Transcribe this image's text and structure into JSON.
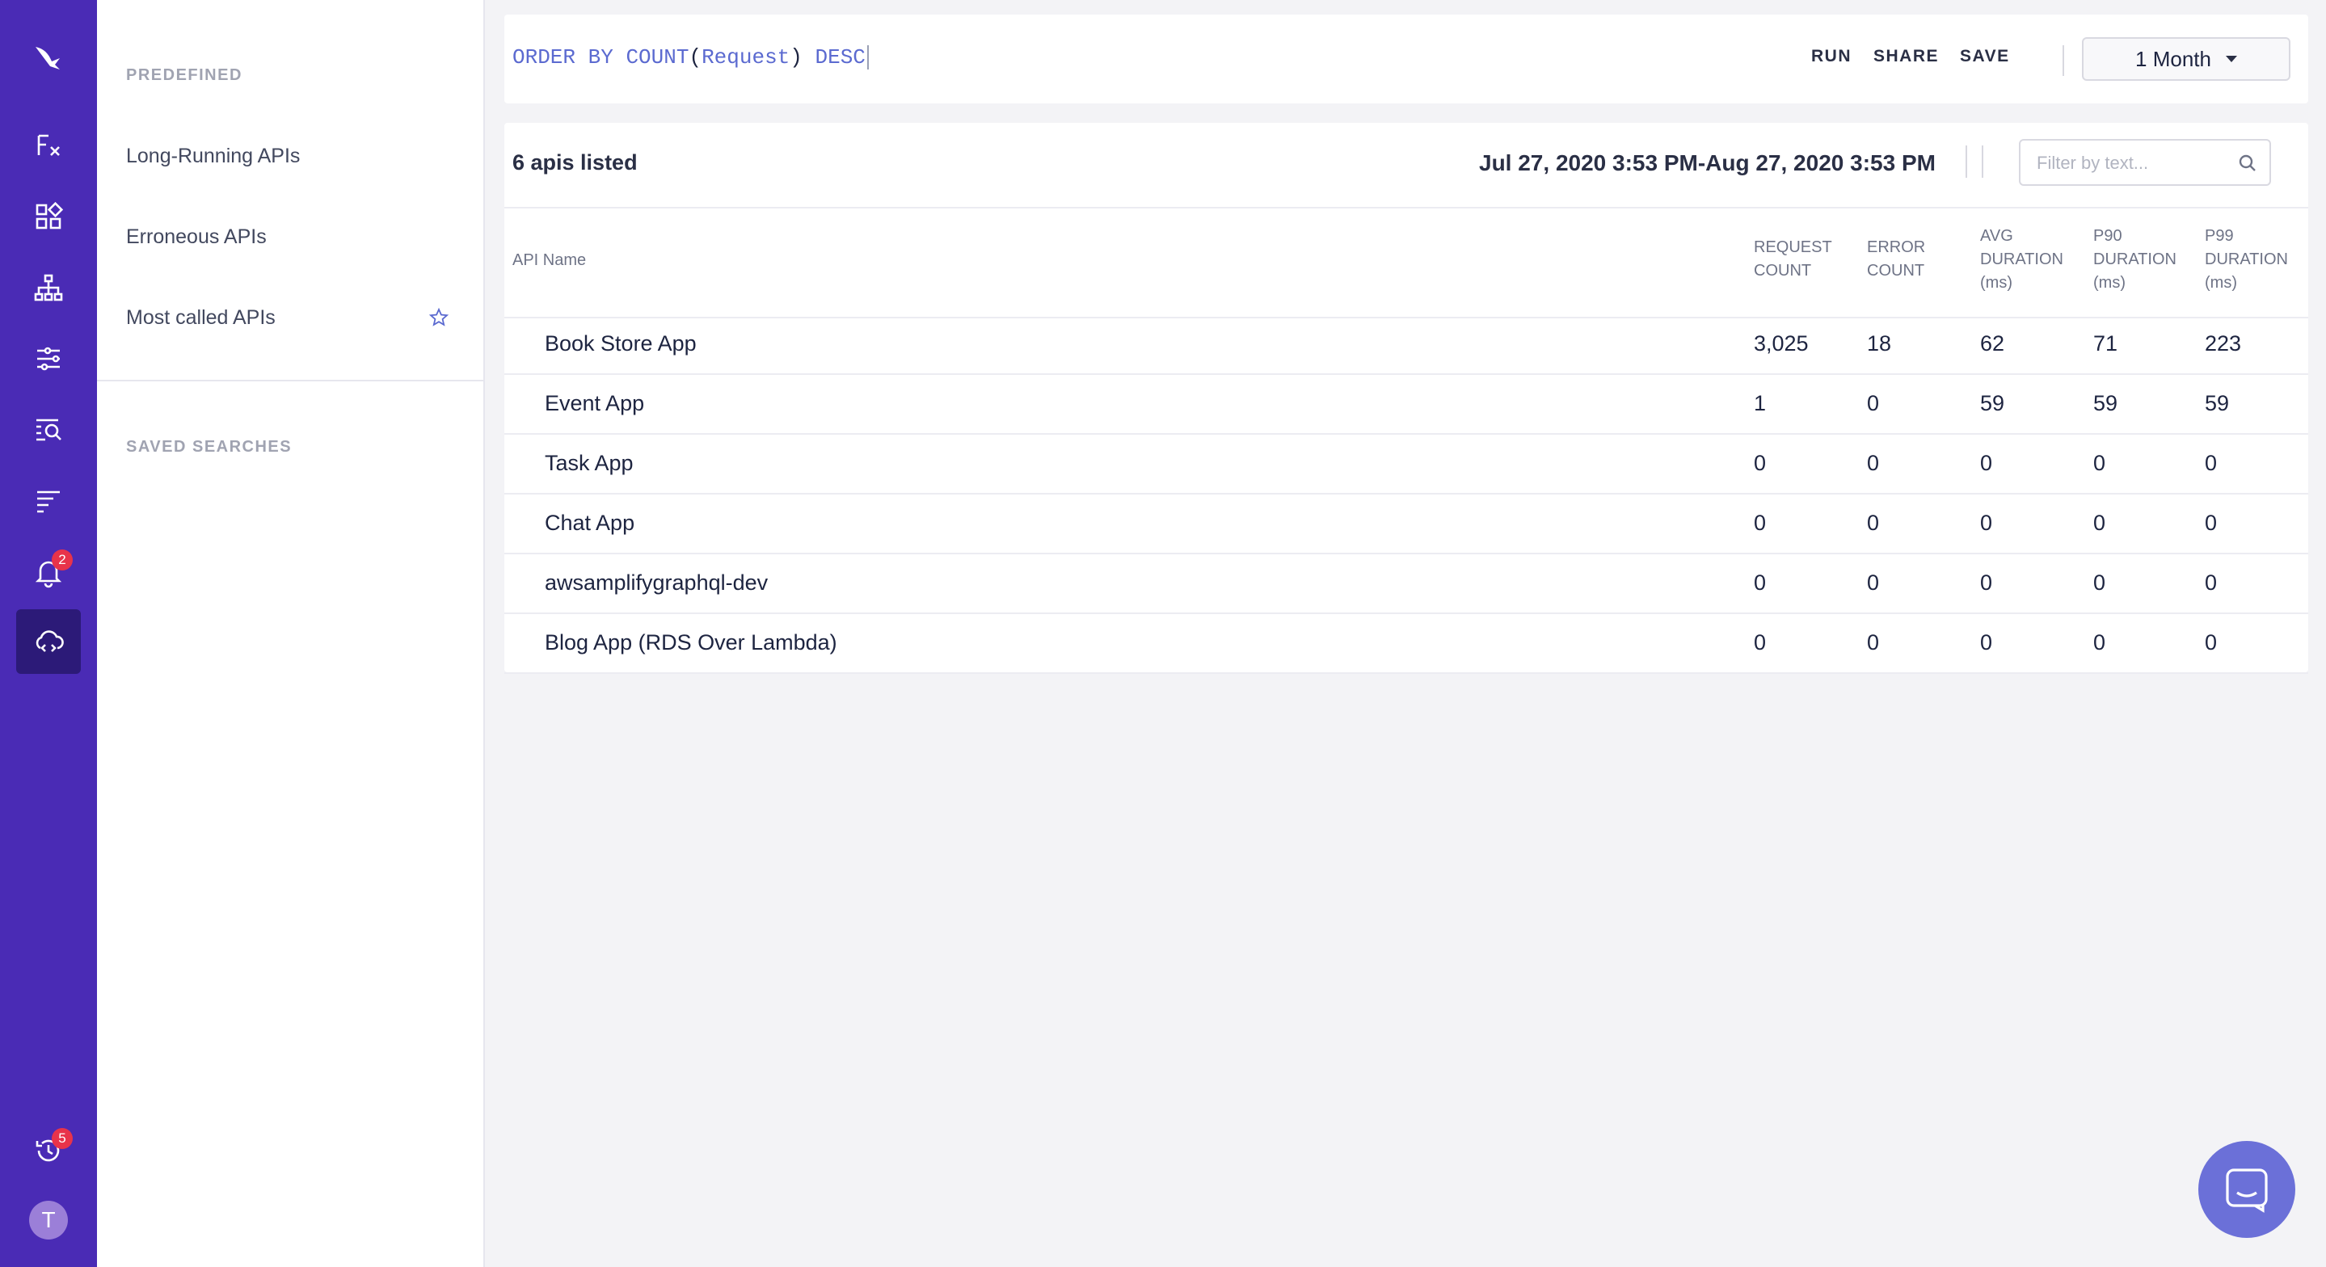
{
  "rail": {
    "items": [
      {
        "name": "logo-icon"
      },
      {
        "name": "functions-icon"
      },
      {
        "name": "dashboard-icon"
      },
      {
        "name": "architecture-icon"
      },
      {
        "name": "filters-icon"
      },
      {
        "name": "search-logs-icon"
      },
      {
        "name": "list-icon"
      },
      {
        "name": "bell-icon",
        "badge": "2"
      },
      {
        "name": "api-cloud-icon",
        "active": true
      },
      {
        "name": "history-icon",
        "badge": "5"
      }
    ],
    "avatar_initial": "T",
    "accent": "#4a2bb5",
    "active_bg": "#2c1a78",
    "badge_color": "#e8334a"
  },
  "sidebar": {
    "predefined_title": "PREDEFINED",
    "items": [
      {
        "label": "Long-Running APIs"
      },
      {
        "label": "Erroneous APIs"
      },
      {
        "label": "Most called APIs"
      }
    ],
    "saved_title": "SAVED SEARCHES"
  },
  "query": {
    "kw1": "ORDER BY",
    "fn": "COUNT",
    "open": "(",
    "arg": "Request",
    "close": ")",
    "kw2": "DESC",
    "run_label": "RUN",
    "share_label": "SHARE",
    "save_label": "SAVE",
    "range_label": "1 Month"
  },
  "results": {
    "count_label": "6 apis listed",
    "date_range": "Jul 27, 2020 3:53 PM-Aug 27, 2020 3:53 PM",
    "filter_placeholder": "Filter by text...",
    "columns": {
      "name": "API Name",
      "request_count": [
        "REQUEST",
        "COUNT"
      ],
      "error_count": [
        "ERROR",
        "COUNT"
      ],
      "avg_duration": [
        "AVG",
        "DURATION",
        "(ms)"
      ],
      "p90_duration": [
        "P90",
        "DURATION",
        "(ms)"
      ],
      "p99_duration": [
        "P99",
        "DURATION",
        "(ms)"
      ]
    },
    "rows": [
      {
        "name": "Book Store App",
        "request_count": "3,025",
        "error_count": "18",
        "avg": "62",
        "p90": "71",
        "p99": "223"
      },
      {
        "name": "Event App",
        "request_count": "1",
        "error_count": "0",
        "avg": "59",
        "p90": "59",
        "p99": "59"
      },
      {
        "name": "Task App",
        "request_count": "0",
        "error_count": "0",
        "avg": "0",
        "p90": "0",
        "p99": "0"
      },
      {
        "name": "Chat App",
        "request_count": "0",
        "error_count": "0",
        "avg": "0",
        "p90": "0",
        "p99": "0"
      },
      {
        "name": "awsamplifygraphql-dev",
        "request_count": "0",
        "error_count": "0",
        "avg": "0",
        "p90": "0",
        "p99": "0"
      },
      {
        "name": "Blog App (RDS Over Lambda)",
        "request_count": "0",
        "error_count": "0",
        "avg": "0",
        "p90": "0",
        "p99": "0"
      }
    ]
  },
  "chat": {
    "icon": "chat-icon",
    "color": "#6b70d8"
  }
}
